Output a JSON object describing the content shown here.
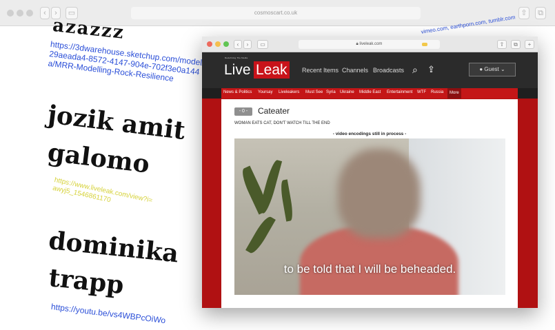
{
  "outer_browser": {
    "url": "cosmoscart.co.uk",
    "back": "‹",
    "forward": "›"
  },
  "artwork": {
    "top_fragment": "azazzz",
    "link_3dwarehouse": "https://3dwarehouse.sketchup.com/model/29aeada4-8572-4147-904e-702f3e0a144a/MRR-Modelling-Rock-Resilience",
    "artist1_line1": "jozik amit",
    "artist1_line2": "galomo",
    "link_liveleak": "https://www.liveleak.com/view?i=awyj5_1546861170",
    "artist2_line1": "dominika",
    "artist2_line2": "trapp",
    "link_youtube": "https://youtu.be/vs4WBPcOiWo",
    "link_top_right": "vimeo.com, earthporn.com, tumblr.com"
  },
  "inner_browser": {
    "url": "liveleak.com",
    "back": "‹",
    "forward": "›"
  },
  "liveleak": {
    "tagline": "Redefining The Media",
    "logo_live": "Live",
    "logo_leak": "Leak",
    "nav": [
      "Recent Items",
      "Channels",
      "Broadcasts"
    ],
    "guest": "Guest",
    "categories": [
      "News & Politics",
      "Yoursay",
      "Liveleakers",
      "Must See",
      "Syria",
      "Ukraine",
      "Middle East",
      "Entertainment",
      "WTF",
      "Russia",
      "More"
    ],
    "badge": "- 0 -",
    "video_title": "Cateater",
    "video_desc": "WOMAN EATS CAT, DON'T WATCH TILL THE END",
    "encoding_note": "- video encodings still in process -",
    "subtitle": "to be told that I will be beheaded."
  }
}
